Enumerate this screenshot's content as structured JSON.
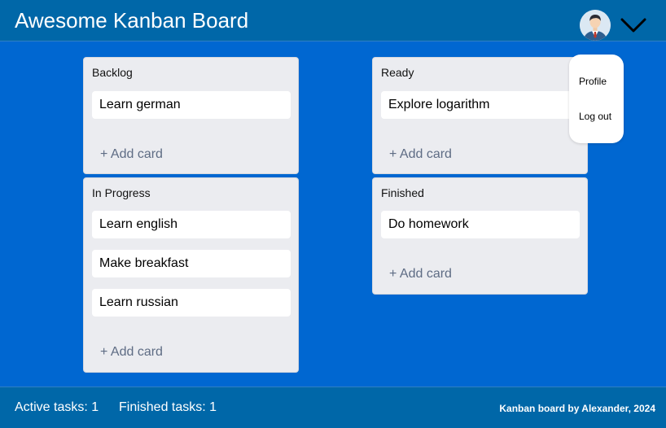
{
  "header": {
    "title": "Awesome Kanban Board",
    "avatar_icon": "user-avatar-icon",
    "menu_icon": "chevron-down-icon"
  },
  "columns": [
    {
      "title": "Backlog",
      "cards": [
        "Learn german"
      ],
      "add_label": "+ Add card"
    },
    {
      "title": "Ready",
      "cards": [
        "Explore logarithm"
      ],
      "add_label": "+ Add card"
    },
    {
      "title": "In Progress",
      "cards": [
        "Learn english",
        "Make breakfast",
        "Learn russian"
      ],
      "add_label": "+ Add card"
    },
    {
      "title": "Finished",
      "cards": [
        "Do homework"
      ],
      "add_label": "+ Add card"
    }
  ],
  "dropdown": {
    "items": [
      "Profile",
      "Log out"
    ]
  },
  "footer": {
    "active_tasks": "Active tasks: 1",
    "finished_tasks": "Finished tasks: 1",
    "credit": "Kanban board by Alexander, 2024"
  },
  "colors": {
    "header_bg": "#0067a8",
    "board_bg": "#0067d1",
    "column_bg": "#ebecf0",
    "card_bg": "#ffffff",
    "add_card_text": "#5e6c84"
  }
}
